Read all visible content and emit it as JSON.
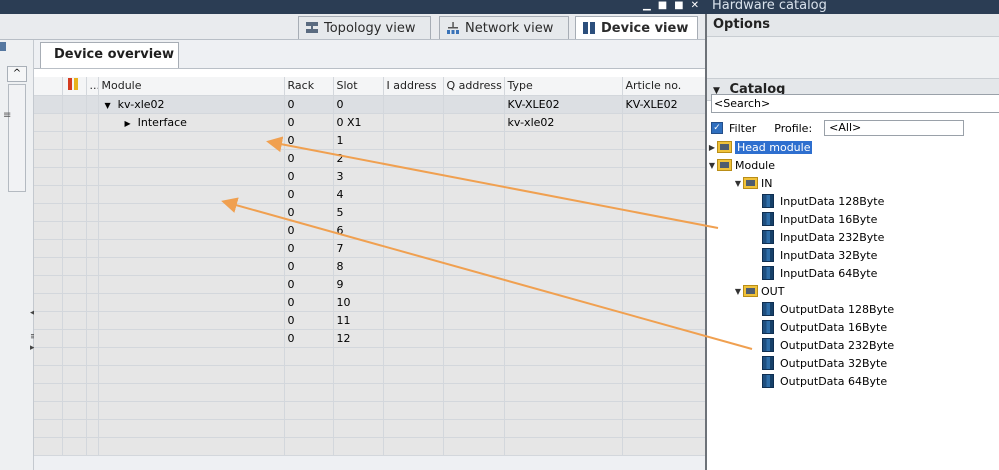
{
  "window": {
    "catalog_title": "Hardware catalog",
    "controls": [
      "▁",
      "■",
      "■",
      "✕"
    ]
  },
  "views": {
    "topology": "Topology view",
    "network": "Network view",
    "device": "Device view"
  },
  "device_overview": {
    "tab_label": "Device overview",
    "columns": [
      "",
      "...",
      "Module",
      "Rack",
      "Slot",
      "I address",
      "Q address",
      "Type",
      "Article no."
    ],
    "rows": [
      {
        "module": "kv-xle02",
        "rack": "0",
        "slot": "0",
        "type": "KV-XLE02",
        "article": "KV-XLE02",
        "expanded": true
      },
      {
        "module": "Interface",
        "rack": "0",
        "slot": "0 X1",
        "type": "kv-xle02",
        "article": "",
        "expanded": false
      },
      {
        "module": "",
        "rack": "0",
        "slot": "1",
        "type": "",
        "article": ""
      },
      {
        "module": "",
        "rack": "0",
        "slot": "2",
        "type": "",
        "article": ""
      },
      {
        "module": "",
        "rack": "0",
        "slot": "3",
        "type": "",
        "article": ""
      },
      {
        "module": "",
        "rack": "0",
        "slot": "4",
        "type": "",
        "article": ""
      },
      {
        "module": "",
        "rack": "0",
        "slot": "5",
        "type": "",
        "article": ""
      },
      {
        "module": "",
        "rack": "0",
        "slot": "6",
        "type": "",
        "article": ""
      },
      {
        "module": "",
        "rack": "0",
        "slot": "7",
        "type": "",
        "article": ""
      },
      {
        "module": "",
        "rack": "0",
        "slot": "8",
        "type": "",
        "article": ""
      },
      {
        "module": "",
        "rack": "0",
        "slot": "9",
        "type": "",
        "article": ""
      },
      {
        "module": "",
        "rack": "0",
        "slot": "10",
        "type": "",
        "article": ""
      },
      {
        "module": "",
        "rack": "0",
        "slot": "11",
        "type": "",
        "article": ""
      },
      {
        "module": "",
        "rack": "0",
        "slot": "12",
        "type": "",
        "article": ""
      }
    ],
    "empty_rows": 6
  },
  "catalog": {
    "options_label": "Options",
    "catalog_label": "Catalog",
    "search_placeholder": "<Search>",
    "filter_label": "Filter",
    "profile_label": "Profile:",
    "profile_value": "<All>",
    "tree": {
      "head_module": "Head module",
      "module": "Module",
      "in": "IN",
      "in_items": [
        "InputData 128Byte",
        "InputData 16Byte",
        "InputData 232Byte",
        "InputData 32Byte",
        "InputData 64Byte"
      ],
      "out": "OUT",
      "out_items": [
        "OutputData 128Byte",
        "OutputData 16Byte",
        "OutputData 232Byte",
        "OutputData 32Byte",
        "OutputData 64Byte"
      ]
    }
  },
  "annotation_color": "#f0a050"
}
